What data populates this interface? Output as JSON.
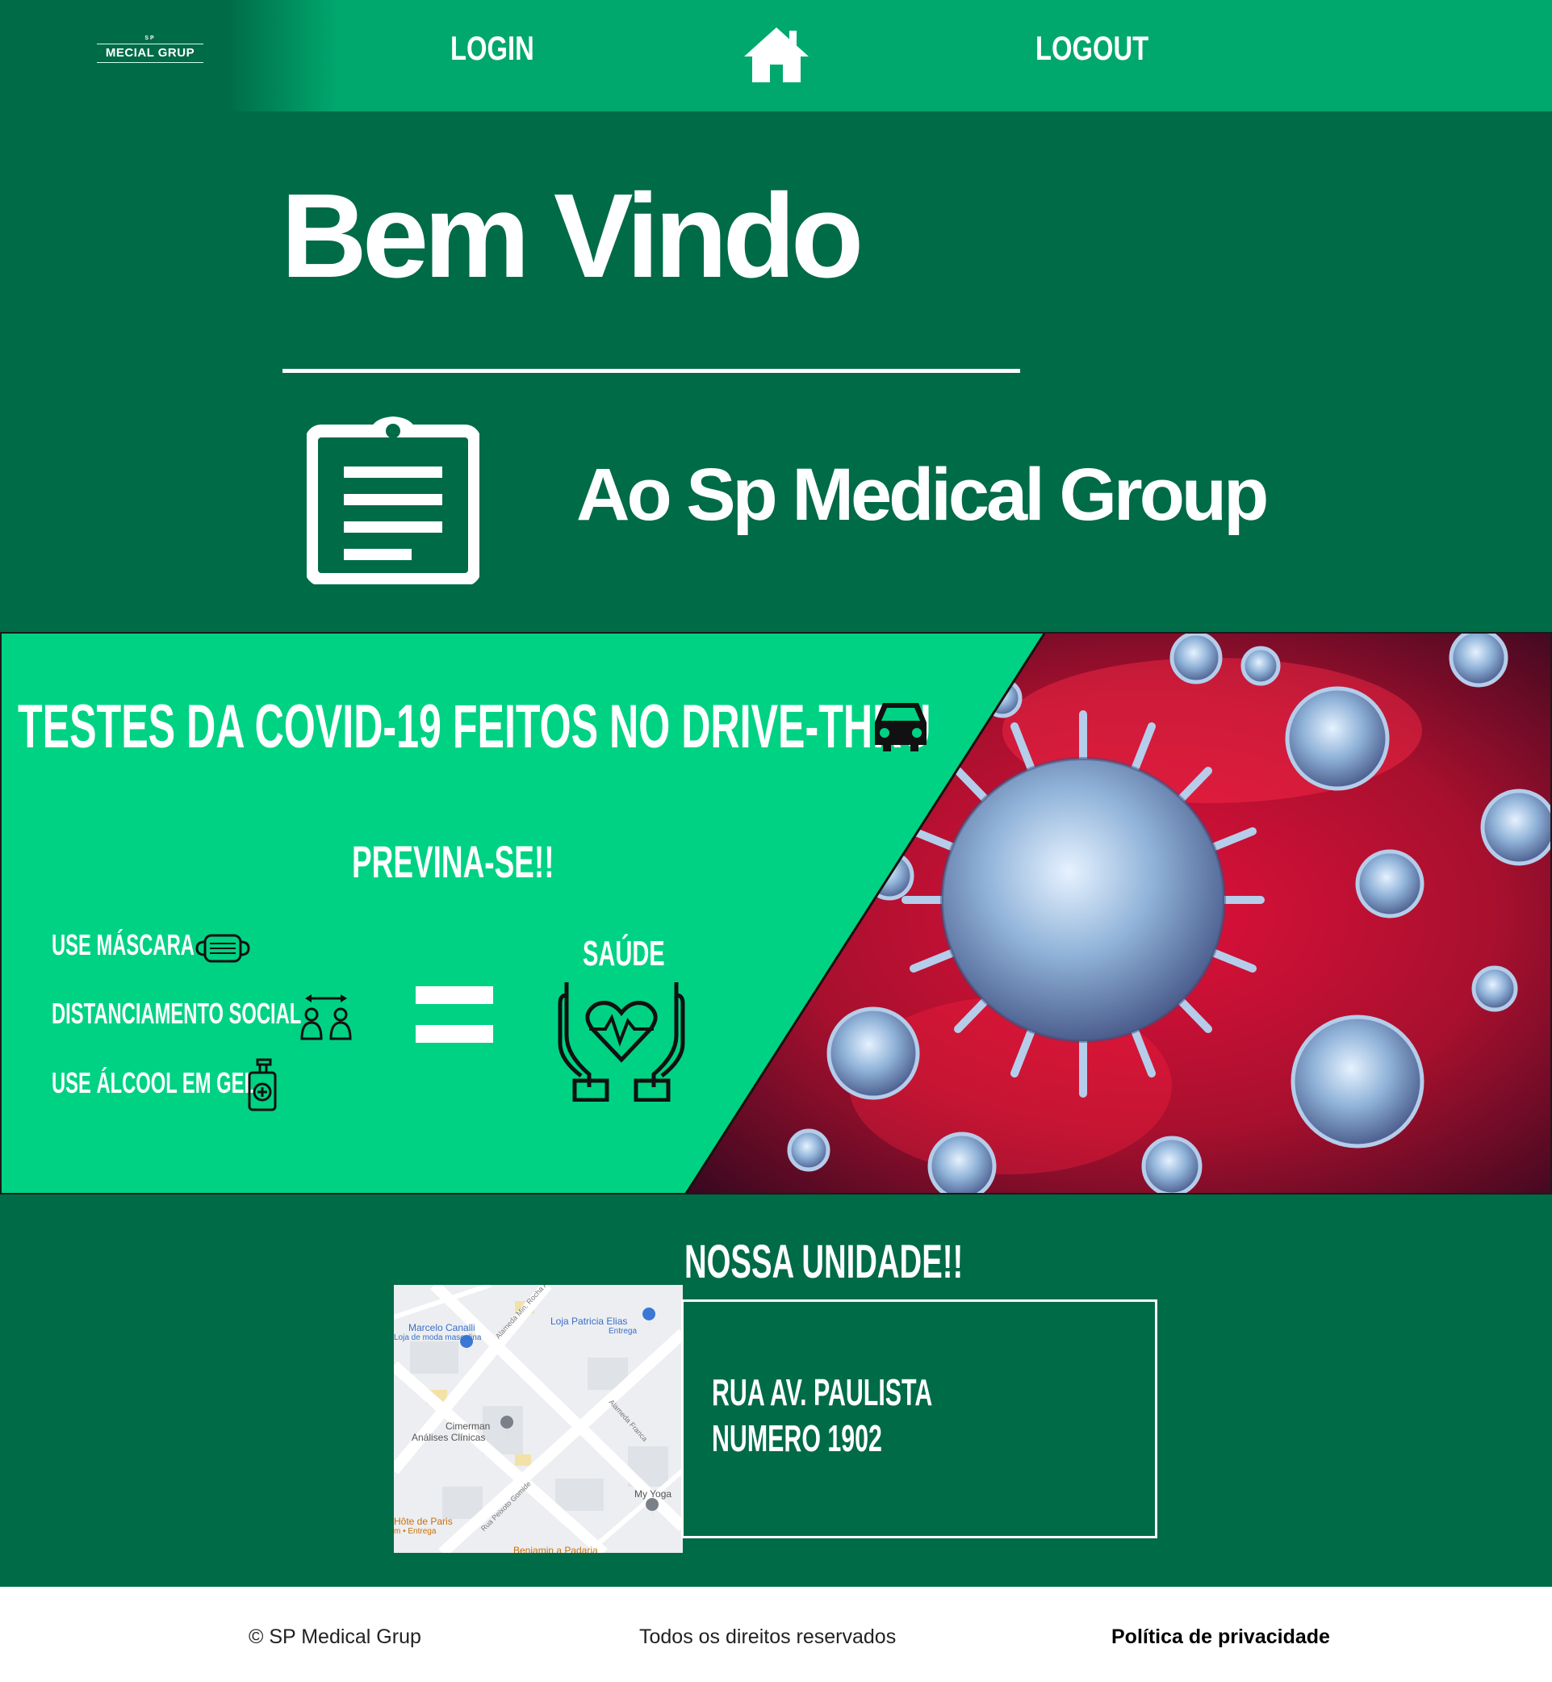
{
  "header": {
    "logo_top": "SP",
    "logo_name": "MECIAL GRUP",
    "login": "LOGIN",
    "logout": "LOGOUT",
    "home_icon": "home-icon"
  },
  "welcome": {
    "title": "Bem Vindo",
    "subtitle": "Ao Sp Medical Group",
    "icon": "clipboard-icon"
  },
  "covid": {
    "title": "TESTES DA COVID-19 FEITOS NO DRIVE-THRU",
    "prevent": "PREVINA-SE!!",
    "tips": [
      "USE MÁSCARA",
      "DISTANCIAMENTO SOCIAL",
      "USE ÁLCOOL EM GEL"
    ],
    "result": "SAÚDE",
    "icons": [
      "car-icon",
      "mask-icon",
      "distance-icon",
      "hand-sanitizer-icon",
      "equals-sign",
      "heart-hands-icon",
      "virus-image"
    ]
  },
  "unit": {
    "title": "NOSSA UNIDADE!!",
    "address_line1": "RUA AV. PAULISTA",
    "address_line2": "NUMERO 1902",
    "map_labels": {
      "place1": "Marcelo Canalli",
      "place1_sub": "Loja de moda masculina",
      "place2": "Loja Patricia Elias",
      "place2_sub": "Entrega",
      "place3": "Cimerman",
      "place3_sub": "Análises Clínicas",
      "place4": "My Yoga",
      "place5": "Hôte de Paris",
      "place5_sub": "m • Entrega",
      "place6": "Benjamin a Padaria",
      "street1": "Alameda Min. Rocha Azevedo",
      "street2": "Alameda Franca",
      "street3": "Rua Peixoto Gomide"
    }
  },
  "footer": {
    "copyright": "© SP Medical Grup",
    "rights": "Todos os direitos reservados",
    "privacy": "Política de privacidade"
  },
  "colors": {
    "dark_green": "#006b47",
    "header_green": "#00a86e",
    "banner_green": "#00d284",
    "virus_red": "#c8102e"
  }
}
